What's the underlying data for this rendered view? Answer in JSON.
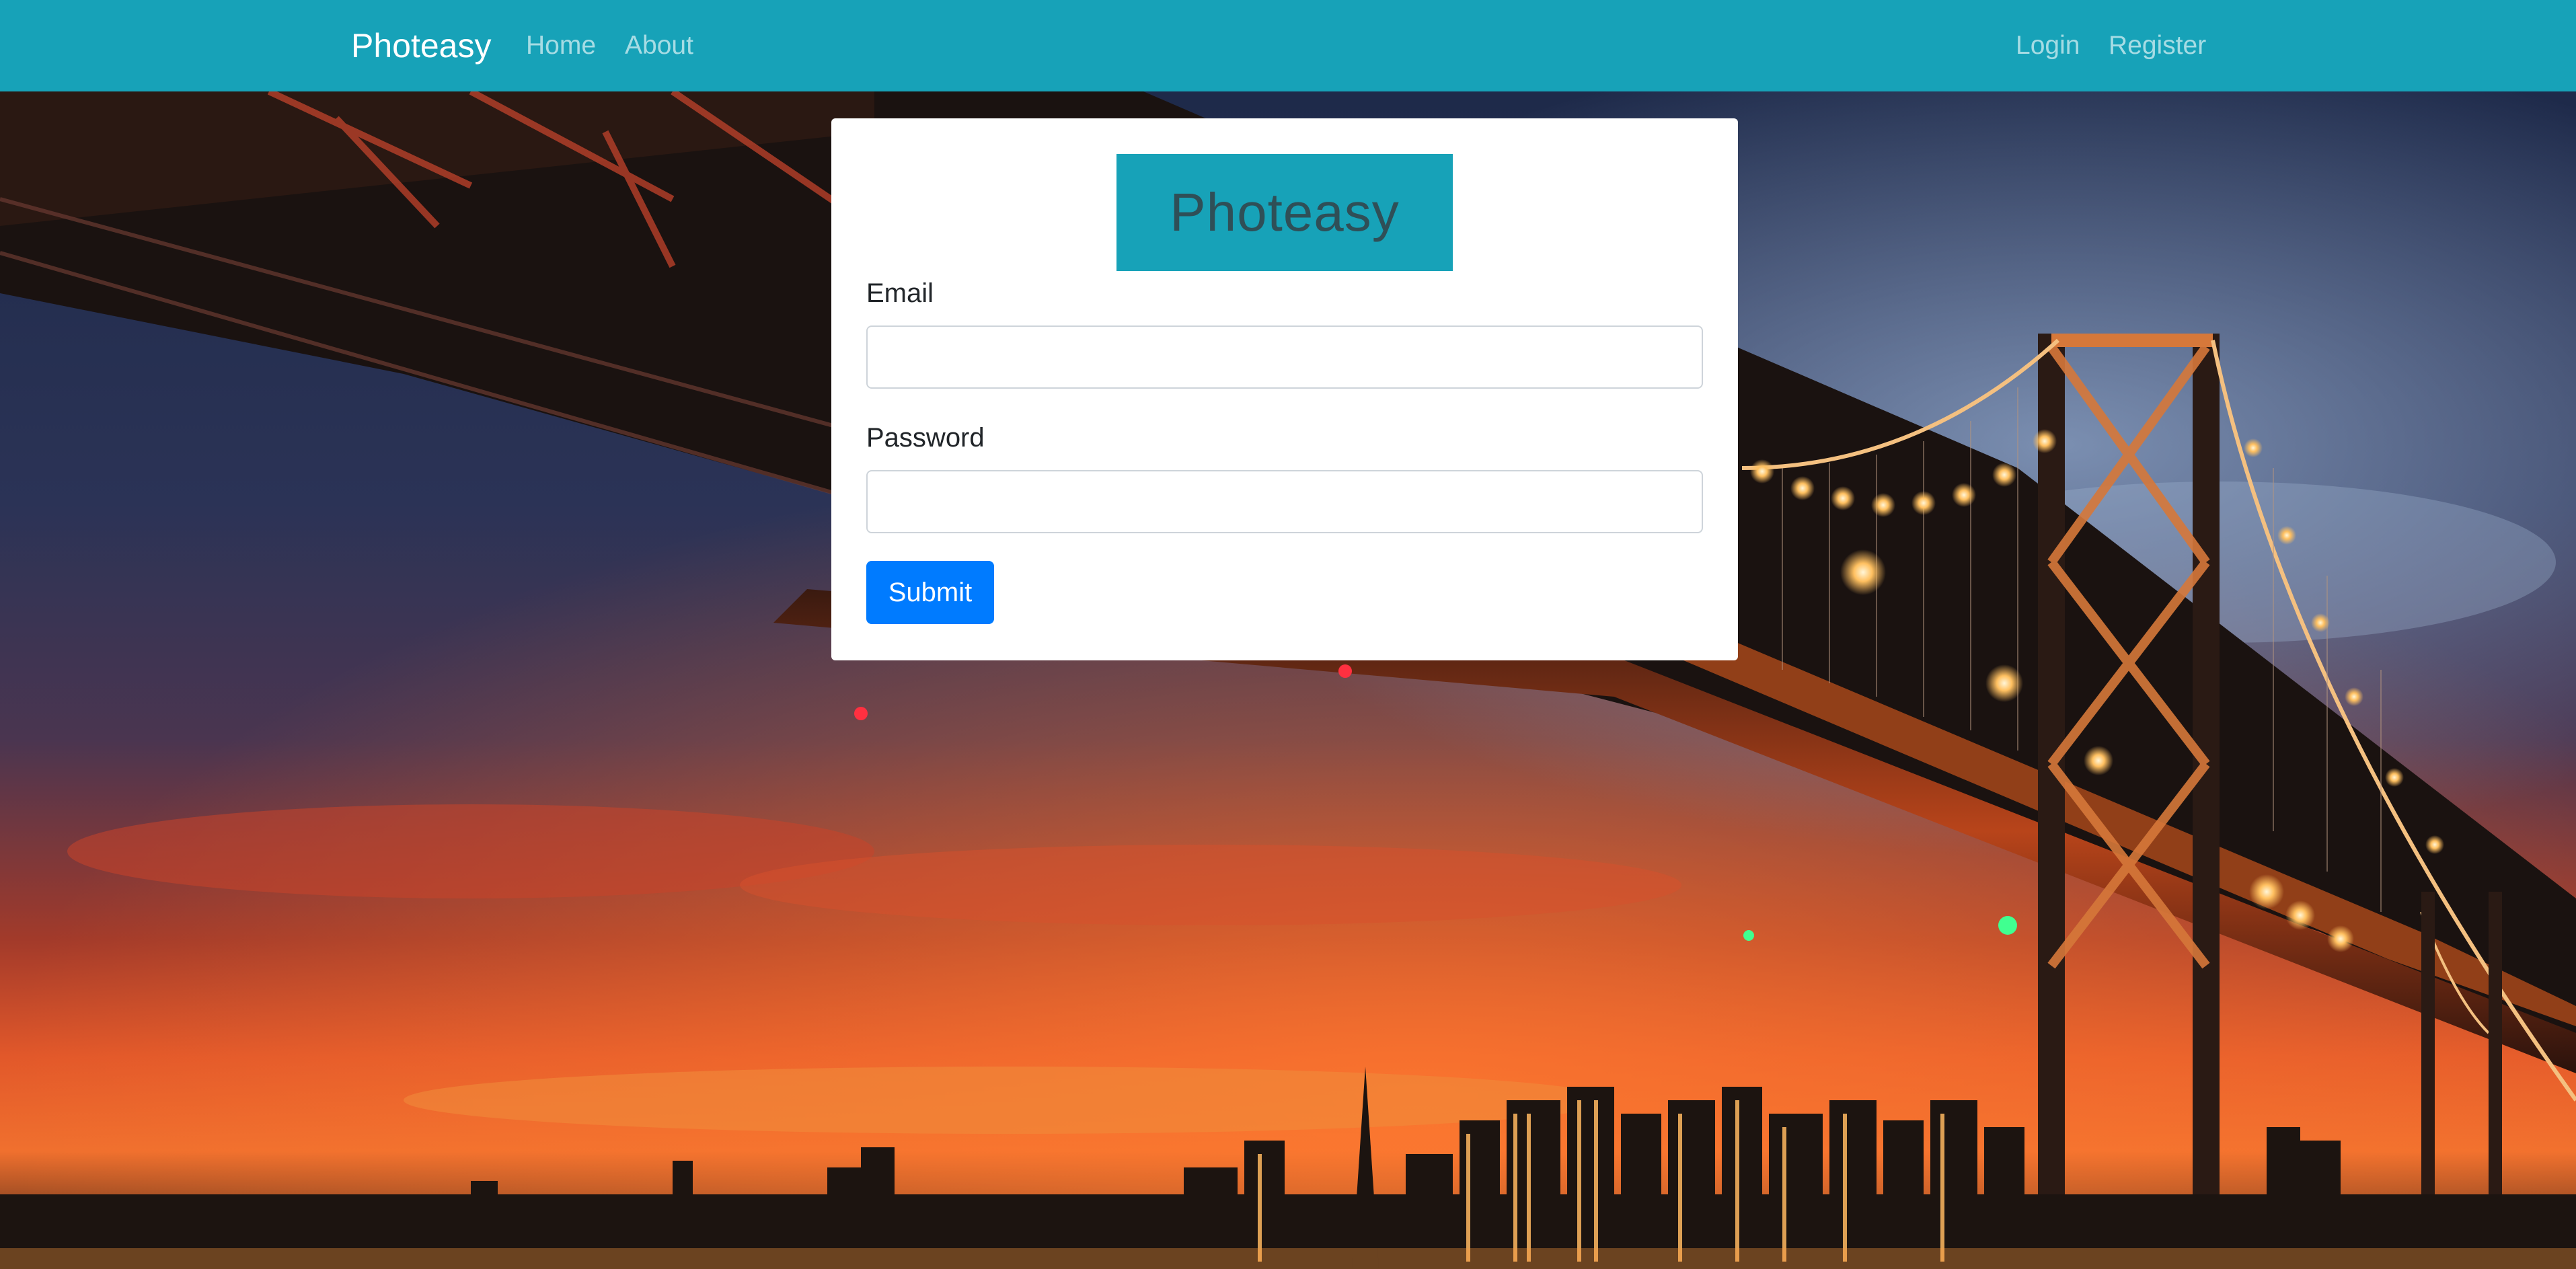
{
  "navbar": {
    "brand": "Photeasy",
    "links": [
      {
        "label": "Home"
      },
      {
        "label": "About"
      }
    ],
    "right_links": [
      {
        "label": "Login"
      },
      {
        "label": "Register"
      }
    ],
    "color": "#17a2b8"
  },
  "login_form": {
    "logo_text": "Photeasy",
    "email_label": "Email",
    "email_value": "",
    "password_label": "Password",
    "password_value": "",
    "submit_label": "Submit",
    "submit_color": "#007bff"
  },
  "background": {
    "description_icon": "bridge-night-cityscape-image"
  }
}
